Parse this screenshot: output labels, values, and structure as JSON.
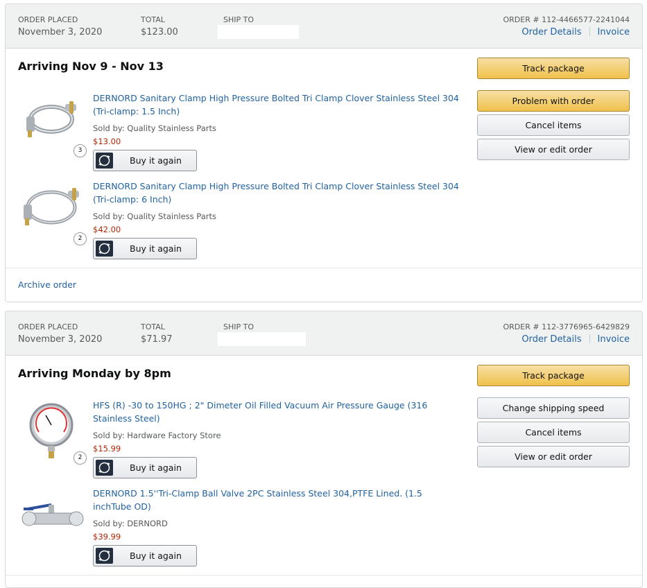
{
  "orders": [
    {
      "header": {
        "order_placed_label": "ORDER PLACED",
        "order_placed_value": "November 3, 2020",
        "total_label": "TOTAL",
        "total_value": "$123.00",
        "ship_to_label": "SHIP TO",
        "order_number": "ORDER # 112-4466577-2241044",
        "order_details_link": "Order Details",
        "invoice_link": "Invoice"
      },
      "arriving": "Arriving Nov 9 - Nov 13",
      "items": [
        {
          "title": "DERNORD Sanitary Clamp High Pressure Bolted Tri Clamp Clover Stainless Steel 304 (Tri-clamp: 1.5 Inch)",
          "sold_by": "Sold by: Quality Stainless Parts",
          "price": "$13.00",
          "qty": "3",
          "buy_again": "Buy it again"
        },
        {
          "title": "DERNORD Sanitary Clamp High Pressure Bolted Tri Clamp Clover Stainless Steel 304 (Tri-clamp: 6 Inch)",
          "sold_by": "Sold by: Quality Stainless Parts",
          "price": "$42.00",
          "qty": "2",
          "buy_again": "Buy it again"
        }
      ],
      "actions": [
        "Track package",
        "Problem with order",
        "Cancel items",
        "View or edit order"
      ],
      "footer_link": "Archive order"
    },
    {
      "header": {
        "order_placed_label": "ORDER PLACED",
        "order_placed_value": "November 3, 2020",
        "total_label": "TOTAL",
        "total_value": "$71.97",
        "ship_to_label": "SHIP TO",
        "order_number": "ORDER # 112-3776965-6429829",
        "order_details_link": "Order Details",
        "invoice_link": "Invoice"
      },
      "arriving": "Arriving Monday by 8pm",
      "items": [
        {
          "title": "HFS (R) -30 to 150HG ; 2\" Dimeter Oil Filled Vacuum Air Pressure Gauge (316 Stainless Steel)",
          "sold_by": "Sold by: Hardware Factory Store",
          "price": "$15.99",
          "qty": "2",
          "buy_again": "Buy it again"
        },
        {
          "title": "DERNORD 1.5''Tri-Clamp Ball Valve 2PC Stainless Steel 304,PTFE Lined. (1.5 inchTube OD)",
          "sold_by": "Sold by: DERNORD",
          "price": "$39.99",
          "qty": "",
          "buy_again": "Buy it again"
        }
      ],
      "actions": [
        "Track package",
        "Change shipping speed",
        "Cancel items",
        "View or edit order"
      ]
    }
  ],
  "colors": {
    "link": "#2162a1",
    "price": "#b12704",
    "primary_button": "#f0c14b",
    "header_bg": "#f0f2f2"
  },
  "icons": {
    "buy_again": "reorder-icon",
    "product_1": "tri-clamp-image",
    "product_2": "tri-clamp-image",
    "product_3": "pressure-gauge-image",
    "product_4": "ball-valve-image"
  }
}
